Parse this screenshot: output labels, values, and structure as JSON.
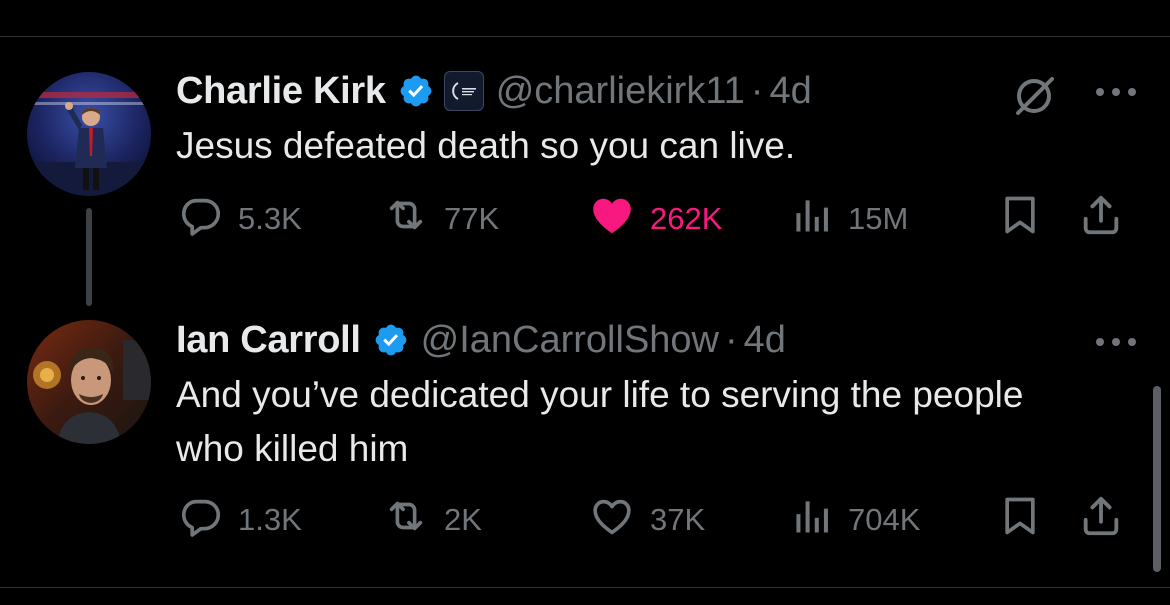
{
  "tweets": [
    {
      "author_name": "Charlie Kirk",
      "handle": "@charliekirk11",
      "time": "4d",
      "text": "Jesus defeated death so you can live.",
      "stats": {
        "replies": "5.3K",
        "reposts": "77K",
        "likes": "262K",
        "views": "15M"
      },
      "liked": true
    },
    {
      "author_name": "Ian Carroll",
      "handle": "@IanCarrollShow",
      "time": "4d",
      "text": "And you’ve dedicated your life to serving the people who killed him",
      "stats": {
        "replies": "1.3K",
        "reposts": "2K",
        "likes": "37K",
        "views": "704K"
      },
      "liked": false
    }
  ],
  "separator": "·",
  "colors": {
    "background": "#000000",
    "text_primary": "#e7e9ea",
    "text_secondary": "#71767b",
    "like_active": "#f91880",
    "verified": "#1d9bf0"
  },
  "icons": [
    "reply-icon",
    "repost-icon",
    "like-icon",
    "views-icon",
    "bookmark-icon",
    "share-icon",
    "more-icon",
    "grok-icon",
    "verified-icon"
  ]
}
